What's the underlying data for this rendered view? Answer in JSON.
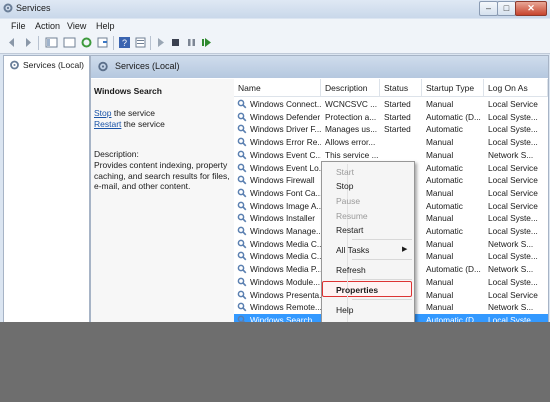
{
  "window": {
    "title": "Services"
  },
  "menubar": [
    "File",
    "Action",
    "View",
    "Help"
  ],
  "toolbar": {
    "icons": [
      "back-icon",
      "forward-icon",
      "show-hide-tree-icon",
      "console-tree-icon",
      "refresh-icon",
      "export-list-icon",
      "help-icon",
      "properties-icon",
      "start-service-icon",
      "stop-service-icon",
      "pause-service-icon",
      "restart-service-icon"
    ]
  },
  "tree": {
    "root_label": "Services (Local)"
  },
  "panel": {
    "header_title": "Services (Local)",
    "selected_service": "Windows Search",
    "stop_link": "Stop",
    "stop_suffix": " the service",
    "restart_link": "Restart",
    "restart_suffix": " the service",
    "description_label": "Description:",
    "description_text": "Provides content indexing, property caching, and search results for files, e-mail, and other content."
  },
  "table": {
    "columns": [
      "Name",
      "Description",
      "Status",
      "Startup Type",
      "Log On As"
    ],
    "rows": [
      [
        "Windows Connect...",
        "WCNCSVC ...",
        "Started",
        "Manual",
        "Local Service"
      ],
      [
        "Windows Defender",
        "Protection a...",
        "Started",
        "Automatic (D...",
        "Local Syste..."
      ],
      [
        "Windows Driver F...",
        "Manages us...",
        "Started",
        "Automatic",
        "Local Syste..."
      ],
      [
        "Windows Error Re...",
        "Allows error...",
        "",
        "Manual",
        "Local Syste..."
      ],
      [
        "Windows Event C...",
        "This service ...",
        "",
        "Manual",
        "Network S..."
      ],
      [
        "Windows Event Lo...",
        "",
        "",
        "Automatic",
        "Local Service"
      ],
      [
        "Windows Firewall",
        "",
        "",
        "Automatic",
        "Local Service"
      ],
      [
        "Windows Font Ca...",
        "",
        "",
        "Manual",
        "Local Service"
      ],
      [
        "Windows Image A...",
        "",
        "",
        "Automatic",
        "Local Service"
      ],
      [
        "Windows Installer",
        "",
        "",
        "Manual",
        "Local Syste..."
      ],
      [
        "Windows Manage...",
        "",
        "",
        "Automatic",
        "Local Syste..."
      ],
      [
        "Windows Media C...",
        "",
        "",
        "Manual",
        "Network S..."
      ],
      [
        "Windows Media C...",
        "",
        "",
        "Manual",
        "Local Syste..."
      ],
      [
        "Windows Media P...",
        "",
        "",
        "Automatic (D...",
        "Network S..."
      ],
      [
        "Windows Module...",
        "",
        "",
        "Manual",
        "Local Syste..."
      ],
      [
        "Windows Presenta...",
        "",
        "",
        "Manual",
        "Local Service"
      ],
      [
        "Windows Remote...",
        "",
        "",
        "Manual",
        "Network S..."
      ],
      [
        "Windows Search",
        "",
        "",
        "Automatic (D...",
        "Local Syste..."
      ]
    ],
    "selected_index": 17
  },
  "context_menu": {
    "items": [
      {
        "label": "Start",
        "state": "disabled"
      },
      {
        "label": "Stop",
        "state": "enabled"
      },
      {
        "label": "Pause",
        "state": "disabled"
      },
      {
        "label": "Resume",
        "state": "disabled"
      },
      {
        "label": "Restart",
        "state": "enabled"
      },
      {
        "label": "All Tasks",
        "state": "submenu"
      },
      {
        "label": "Refresh",
        "state": "enabled"
      },
      {
        "label": "Properties",
        "state": "highlighted"
      },
      {
        "label": "Help",
        "state": "enabled"
      }
    ]
  },
  "colors": {
    "selection": "#3399ff",
    "link": "#1a54a8",
    "highlight_border": "#dd3333"
  }
}
